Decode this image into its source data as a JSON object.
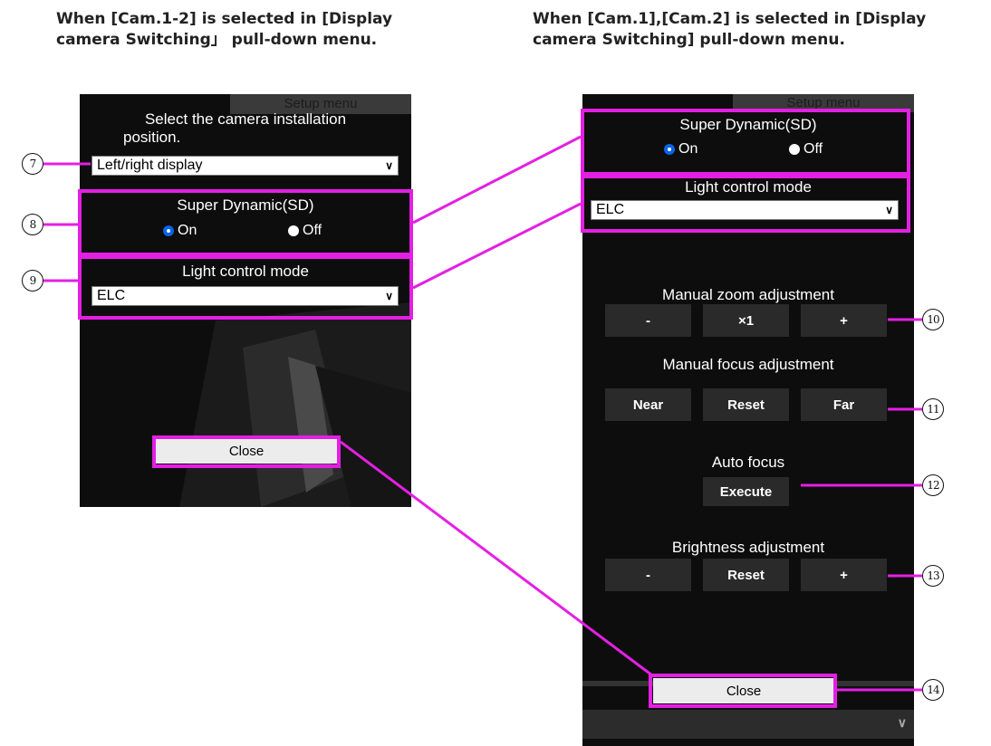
{
  "headings": {
    "left": [
      "When [Cam.1-2] is selected in [Display",
      "camera Switching」 pull-down menu."
    ],
    "right": [
      "When [Cam.1],[Cam.2] is selected in [Display",
      "camera Switching] pull-down menu."
    ]
  },
  "left_panel": {
    "tab_label": "Setup menu",
    "install_label_line1": "Select the camera installation",
    "install_label_line2": "position.",
    "install_select_value": "Left/right display",
    "sd_label": "Super Dynamic(SD)",
    "sd_on": "On",
    "sd_off": "Off",
    "light_label": "Light control mode",
    "light_select_value": "ELC",
    "close_label": "Close"
  },
  "right_panel": {
    "tab_label": "Setup menu",
    "sd_label": "Super Dynamic(SD)",
    "sd_on": "On",
    "sd_off": "Off",
    "light_label": "Light control mode",
    "light_select_value": "ELC",
    "zoom_label": "Manual zoom adjustment",
    "zoom_minus": "-",
    "zoom_x1": "×1",
    "zoom_plus": "+",
    "focus_label": "Manual focus adjustment",
    "focus_near": "Near",
    "focus_reset": "Reset",
    "focus_far": "Far",
    "af_label": "Auto focus",
    "af_execute": "Execute",
    "bright_label": "Brightness adjustment",
    "bright_minus": "-",
    "bright_reset": "Reset",
    "bright_plus": "+",
    "close_label": "Close"
  },
  "callouts": {
    "n7": "7",
    "n8": "8",
    "n9": "9",
    "n10": "10",
    "n11": "11",
    "n12": "12",
    "n13": "13",
    "n14": "14"
  },
  "colors": {
    "highlight": "#e41fe4",
    "panel_bg": "#0d0d0d",
    "radio_selected": "#0a64e6"
  }
}
